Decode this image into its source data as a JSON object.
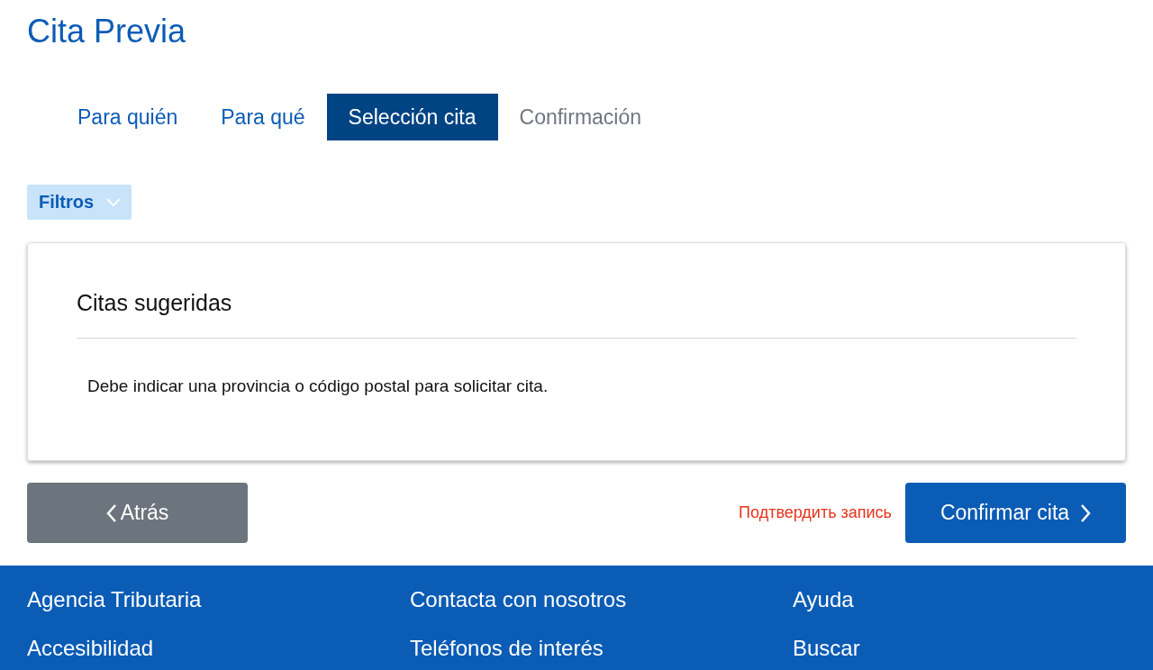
{
  "page_title": "Cita Previa",
  "steps": [
    {
      "label": "Para quién",
      "selected": false,
      "disabled": false
    },
    {
      "label": "Para qué",
      "selected": false,
      "disabled": false
    },
    {
      "label": "Selección cita",
      "selected": true,
      "disabled": false
    },
    {
      "label": "Confirmación",
      "selected": false,
      "disabled": true
    }
  ],
  "filters": {
    "label": "Filtros",
    "expanded": false
  },
  "card": {
    "title": "Citas sugeridas",
    "message": "Debe indicar una provincia o código postal para solicitar cita."
  },
  "actions": {
    "back": "Atrás",
    "note": "Подтвердить запись",
    "confirm": "Confirmar cita"
  },
  "footer": [
    [
      "Agencia Tributaria",
      "Accesibilidad"
    ],
    [
      "Contacta con nosotros",
      "Teléfonos de interés"
    ],
    [
      "Ayuda",
      "Buscar"
    ]
  ]
}
